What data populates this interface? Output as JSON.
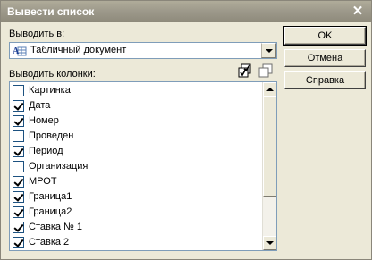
{
  "window": {
    "title": "Вывести список"
  },
  "output": {
    "label": "Выводить в:",
    "selected": "Табличный документ"
  },
  "columns": {
    "label": "Выводить колонки:",
    "items": [
      {
        "label": "Картинка",
        "checked": false
      },
      {
        "label": "Дата",
        "checked": true
      },
      {
        "label": "Номер",
        "checked": true
      },
      {
        "label": "Проведен",
        "checked": false
      },
      {
        "label": "Период",
        "checked": true
      },
      {
        "label": "Организация",
        "checked": false
      },
      {
        "label": "МРОТ",
        "checked": true
      },
      {
        "label": "Граница1",
        "checked": true
      },
      {
        "label": "Граница2",
        "checked": true
      },
      {
        "label": "Ставка № 1",
        "checked": true
      },
      {
        "label": "Ставка 2",
        "checked": true
      }
    ]
  },
  "buttons": {
    "ok": "OK",
    "cancel": "Отмена",
    "help": "Справка"
  },
  "icons": {
    "close": "close-icon",
    "document": "spreadsheet-document-icon",
    "check_all": "check-all-icon",
    "uncheck_all": "uncheck-all-icon"
  }
}
